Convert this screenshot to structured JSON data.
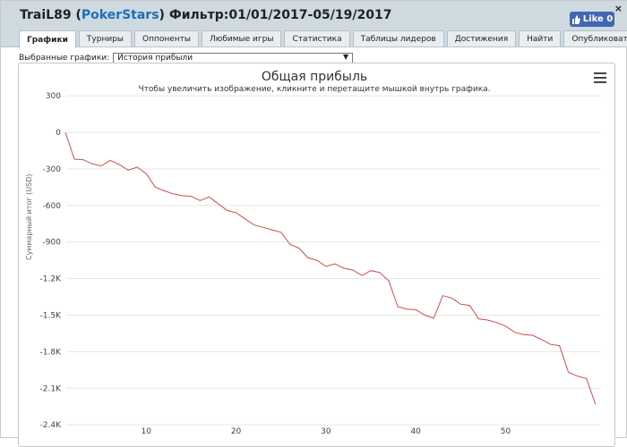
{
  "header": {
    "player": "TraiL89",
    "paren_open": " (",
    "site": "PokerStars",
    "filter": ") Фильтр:01/01/2017-05/19/2017",
    "close_label": "×",
    "like_label": "Like 0"
  },
  "tabs": [
    {
      "label": "Графики",
      "active": true
    },
    {
      "label": "Турниры"
    },
    {
      "label": "Оппоненты"
    },
    {
      "label": "Любимые игры"
    },
    {
      "label": "Статистика"
    },
    {
      "label": "Таблицы лидеров"
    },
    {
      "label": "Достижения"
    },
    {
      "label": "Найти"
    },
    {
      "label": "Опубликовать"
    }
  ],
  "selector": {
    "label": "Выбранные графики:",
    "value": "История прибыли",
    "arrow": "▼"
  },
  "chart_data": {
    "type": "line",
    "title": "Общая прибыль",
    "subtitle": "Чтобы увеличить изображение, кликните и перетащите мышкой внутрь графика.",
    "ylabel": "Суммарный итог (USD)",
    "xlabel": "",
    "ylim": [
      -2400,
      300
    ],
    "xlim": [
      1,
      60
    ],
    "yticks": [
      300,
      0,
      -300,
      -600,
      -900,
      -1200,
      -1500,
      -1800,
      -2100,
      -2400
    ],
    "ytick_labels": [
      "300",
      "0",
      "-300",
      "-600",
      "-900",
      "-1.2K",
      "-1.5K",
      "-1.8K",
      "-2.1K",
      "-2.4K"
    ],
    "xticks": [
      10,
      20,
      30,
      40,
      50
    ],
    "xtick_labels": [
      "10",
      "20",
      "30",
      "40",
      "50"
    ],
    "grid": "horizontal",
    "color": "#c0504d",
    "series": [
      {
        "x": [
          1,
          2,
          3,
          4,
          5,
          6,
          7,
          8,
          9,
          10,
          11,
          12,
          13,
          14,
          15,
          16,
          17,
          18,
          19,
          20,
          21,
          22,
          23,
          24,
          25,
          26,
          27,
          28,
          29,
          30,
          31,
          32,
          33,
          34,
          35,
          36,
          37,
          38,
          39,
          40,
          41,
          42,
          43,
          44,
          45,
          46,
          47,
          48,
          49,
          50,
          51,
          52,
          53,
          54,
          55,
          56,
          57,
          58,
          59,
          60
        ],
        "y": [
          0,
          -220,
          -225,
          -260,
          -275,
          -230,
          -265,
          -310,
          -285,
          -340,
          -450,
          -480,
          -505,
          -520,
          -525,
          -560,
          -530,
          -585,
          -640,
          -660,
          -710,
          -760,
          -780,
          -800,
          -820,
          -920,
          -950,
          -1030,
          -1050,
          -1100,
          -1080,
          -1115,
          -1130,
          -1175,
          -1135,
          -1150,
          -1220,
          -1430,
          -1450,
          -1455,
          -1500,
          -1525,
          -1340,
          -1360,
          -1410,
          -1420,
          -1530,
          -1540,
          -1560,
          -1590,
          -1640,
          -1660,
          -1665,
          -1700,
          -1740,
          -1750,
          -1970,
          -2000,
          -2020,
          -2230
        ]
      }
    ]
  }
}
